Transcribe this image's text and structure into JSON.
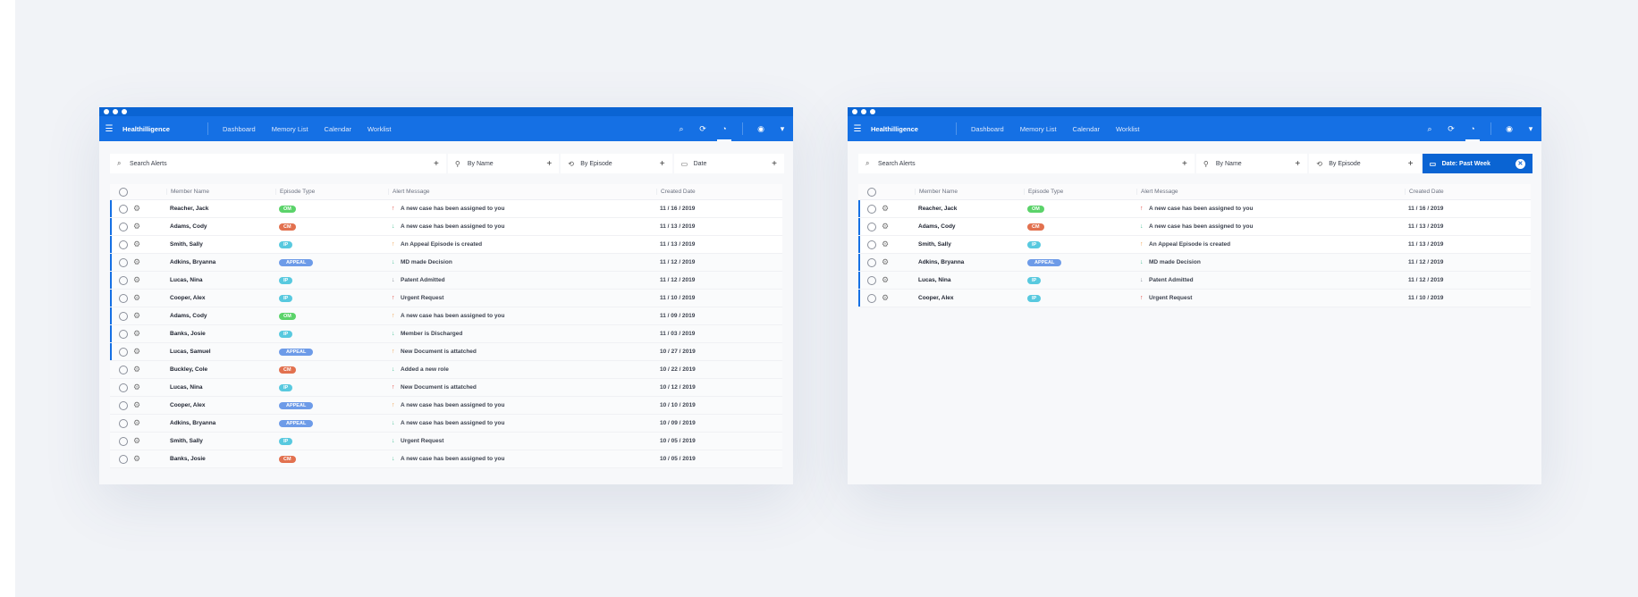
{
  "colors": {
    "brand": "#1570e4",
    "brand_dark": "#0a64d3",
    "badge_OM": "#5bd36a",
    "badge_CM": "#e2714f",
    "badge_IP": "#58c9df",
    "badge_APPEAL": "#6d9be8",
    "status_on": "#32d6a4"
  },
  "app": {
    "logo": "Healthilligence",
    "nav": [
      "Dashboard",
      "Memory List",
      "Calendar",
      "Worklist"
    ],
    "icons": [
      "search-icon",
      "refresh-icon",
      "bell-icon",
      "user-icon",
      "chevron-down-icon"
    ]
  },
  "filters": {
    "search_placeholder": "Search Alerts",
    "by_name": "By Name",
    "by_episode": "By Episode",
    "date": "Date",
    "date_active": "Date: Past Week"
  },
  "columns": {
    "member": "Member Name",
    "episode": "Episode Type",
    "message": "Alert Message",
    "date": "Created Date"
  },
  "left_rows": [
    {
      "name": "Reacher, Jack",
      "type": "OM",
      "arrow": "up",
      "msg": "A new case has been assigned to you",
      "date": "11 / 16 / 2019",
      "status": "on",
      "unread": true
    },
    {
      "name": "Adams, Cody",
      "type": "CM",
      "arrow": "down",
      "msg": "A new case has been assigned to you",
      "date": "11 / 13 / 2019",
      "status": "on",
      "unread": true
    },
    {
      "name": "Smith, Sally",
      "type": "IP",
      "arrow": "up-orange",
      "msg": "An Appeal Episode is created",
      "date": "11 / 13 / 2019",
      "status": "on",
      "unread": true
    },
    {
      "name": "Adkins, Bryanna",
      "type": "APPEAL",
      "arrow": "down",
      "msg": "MD made Decision",
      "date": "11 / 12 / 2019",
      "status": "off",
      "unread": true
    },
    {
      "name": "Lucas, Nina",
      "type": "IP",
      "arrow": "down-gray",
      "msg": "Patent Admitted",
      "date": "11 / 12 / 2019",
      "status": "off",
      "unread": true
    },
    {
      "name": "Cooper, Alex",
      "type": "IP",
      "arrow": "up",
      "msg": "Urgent Request",
      "date": "11 / 10 / 2019",
      "status": "off",
      "unread": true
    },
    {
      "name": "Adams, Cody",
      "type": "OM",
      "arrow": "up-orange",
      "msg": "A new case has been assigned to you",
      "date": "11 / 09 / 2019",
      "status": "off",
      "unread": true
    },
    {
      "name": "Banks, Josie",
      "type": "IP",
      "arrow": "down",
      "msg": "Member is Discharged",
      "date": "11 / 03 / 2019",
      "status": "off",
      "unread": true
    },
    {
      "name": "Lucas, Samuel",
      "type": "APPEAL",
      "arrow": "up-orange",
      "msg": "New Document is attatched",
      "date": "10 / 27 / 2019",
      "status": "off",
      "unread": true
    },
    {
      "name": "Buckley, Cole",
      "type": "CM",
      "arrow": "down",
      "msg": "Added a new role",
      "date": "10 / 22 / 2019",
      "status": "off",
      "unread": false
    },
    {
      "name": "Lucas, Nina",
      "type": "IP",
      "arrow": "up",
      "msg": "New Document is attatched",
      "date": "10 / 12 / 2019",
      "status": "off",
      "unread": false
    },
    {
      "name": "Cooper, Alex",
      "type": "APPEAL",
      "arrow": "up-orange",
      "msg": "A new case has been assigned to you",
      "date": "10 / 10 / 2019",
      "status": "off",
      "unread": false
    },
    {
      "name": "Adkins, Bryanna",
      "type": "APPEAL",
      "arrow": "down",
      "msg": "A new case has been assigned to you",
      "date": "10 / 09 / 2019",
      "status": "off",
      "unread": false
    },
    {
      "name": "Smith, Sally",
      "type": "IP",
      "arrow": "down",
      "msg": "Urgent Request",
      "date": "10 / 05 / 2019",
      "status": "off",
      "unread": false
    },
    {
      "name": "Banks, Josie",
      "type": "CM",
      "arrow": "down",
      "msg": "A new case has been assigned to you",
      "date": "10 / 05 / 2019",
      "status": "off",
      "unread": false
    }
  ],
  "right_rows": [
    {
      "name": "Reacher, Jack",
      "type": "OM",
      "arrow": "up",
      "msg": "A new case has been assigned to you",
      "date": "11 / 16 / 2019",
      "status": "on",
      "unread": true
    },
    {
      "name": "Adams, Cody",
      "type": "CM",
      "arrow": "down",
      "msg": "A new case has been assigned to you",
      "date": "11 / 13 / 2019",
      "status": "on",
      "unread": true
    },
    {
      "name": "Smith, Sally",
      "type": "IP",
      "arrow": "up-orange",
      "msg": "An Appeal Episode is created",
      "date": "11 / 13 / 2019",
      "status": "on",
      "unread": true
    },
    {
      "name": "Adkins, Bryanna",
      "type": "APPEAL",
      "arrow": "down",
      "msg": "MD made Decision",
      "date": "11 / 12 / 2019",
      "status": "off",
      "unread": true
    },
    {
      "name": "Lucas, Nina",
      "type": "IP",
      "arrow": "down-gray",
      "msg": "Patent Admitted",
      "date": "11 / 12 / 2019",
      "status": "off",
      "unread": true
    },
    {
      "name": "Cooper, Alex",
      "type": "IP",
      "arrow": "up",
      "msg": "Urgent Request",
      "date": "11 / 10 / 2019",
      "status": "off",
      "unread": true
    }
  ]
}
